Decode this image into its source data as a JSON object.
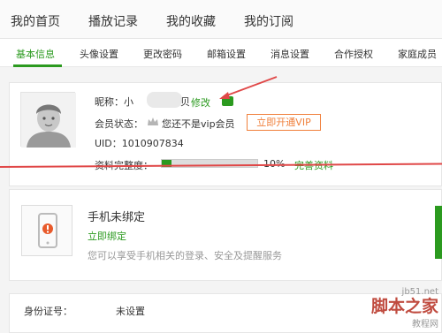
{
  "topnav": {
    "items": [
      "我的首页",
      "播放记录",
      "我的收藏",
      "我的订阅"
    ]
  },
  "subnav": {
    "items": [
      "基本信息",
      "头像设置",
      "更改密码",
      "邮箱设置",
      "消息设置",
      "合作授权",
      "家庭成员"
    ]
  },
  "profile": {
    "nickname_label": "昵称：小",
    "nickname_suffix": "贝",
    "edit_link": "修改",
    "member_status_label": "会员状态：",
    "member_status_text": "您还不是vip会员",
    "vip_button": "立即开通VIP",
    "uid_text": "UID：1010907834",
    "completeness_label": "资料完整度：",
    "completeness_value": "10%",
    "completeness_fraction": 0.1,
    "complete_link": "完善资料"
  },
  "phone": {
    "title": "手机未绑定",
    "bind_link": "立即绑定",
    "description": "您可以享受手机相关的登录、安全及提醒服务"
  },
  "id_card": {
    "label": "身份证号：",
    "value": "未设置"
  },
  "watermark": {
    "line1": "jb51.net",
    "line2": "脚本之家",
    "line3": "教程网"
  },
  "colors": {
    "accent": "#2b9a1f",
    "vip": "#f0803c",
    "annotation": "#e04848"
  }
}
